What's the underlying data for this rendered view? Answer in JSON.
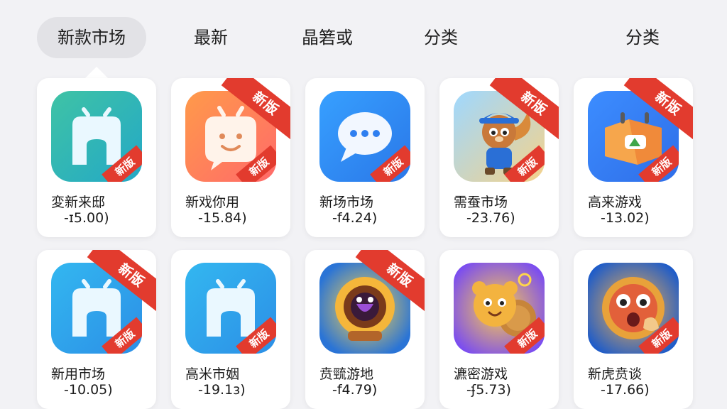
{
  "tabs": [
    {
      "label": "新款市场",
      "active": true
    },
    {
      "label": "最新"
    },
    {
      "label": "晶箬或"
    },
    {
      "label": "分类"
    },
    {
      "label": "分类"
    }
  ],
  "badge_text": "新版",
  "colors": {
    "accent": "#e23b2e",
    "card": "#ffffff",
    "background": "#f2f2f5"
  },
  "apps": [
    {
      "name": "変新来邸",
      "price": "-ɪ5.00)",
      "icon": "robot-tv-icon",
      "ribbon": false
    },
    {
      "name": "新戏你用",
      "price": "-15.84)",
      "icon": "smiley-chat-icon",
      "ribbon": true
    },
    {
      "name": "新场市场",
      "price": "-f4.24)",
      "icon": "chat-bubble-icon",
      "ribbon": false
    },
    {
      "name": "需蚕市场",
      "price": "-23.76)",
      "icon": "squirrel-character-icon",
      "ribbon": true
    },
    {
      "name": "高来游戏",
      "price": "-13.02)",
      "icon": "calendar-map-icon",
      "ribbon": true
    },
    {
      "name": "新用市场",
      "price": "-10.05)",
      "icon": "robot-tv-icon",
      "ribbon": true
    },
    {
      "name": "高米市姻",
      "price": "-19.1ɜ)",
      "icon": "robot-tv-icon",
      "ribbon": false
    },
    {
      "name": "贲巰游地",
      "price": "-f4.79)",
      "icon": "monster-gear-icon",
      "ribbon": true
    },
    {
      "name": "瀌密游戏",
      "price": "-ʄ5.73)",
      "icon": "bear-cookie-icon",
      "ribbon": false
    },
    {
      "name": "新虎贲谈",
      "price": "-17.66)",
      "icon": "surprised-creature-icon",
      "ribbon": false
    }
  ]
}
